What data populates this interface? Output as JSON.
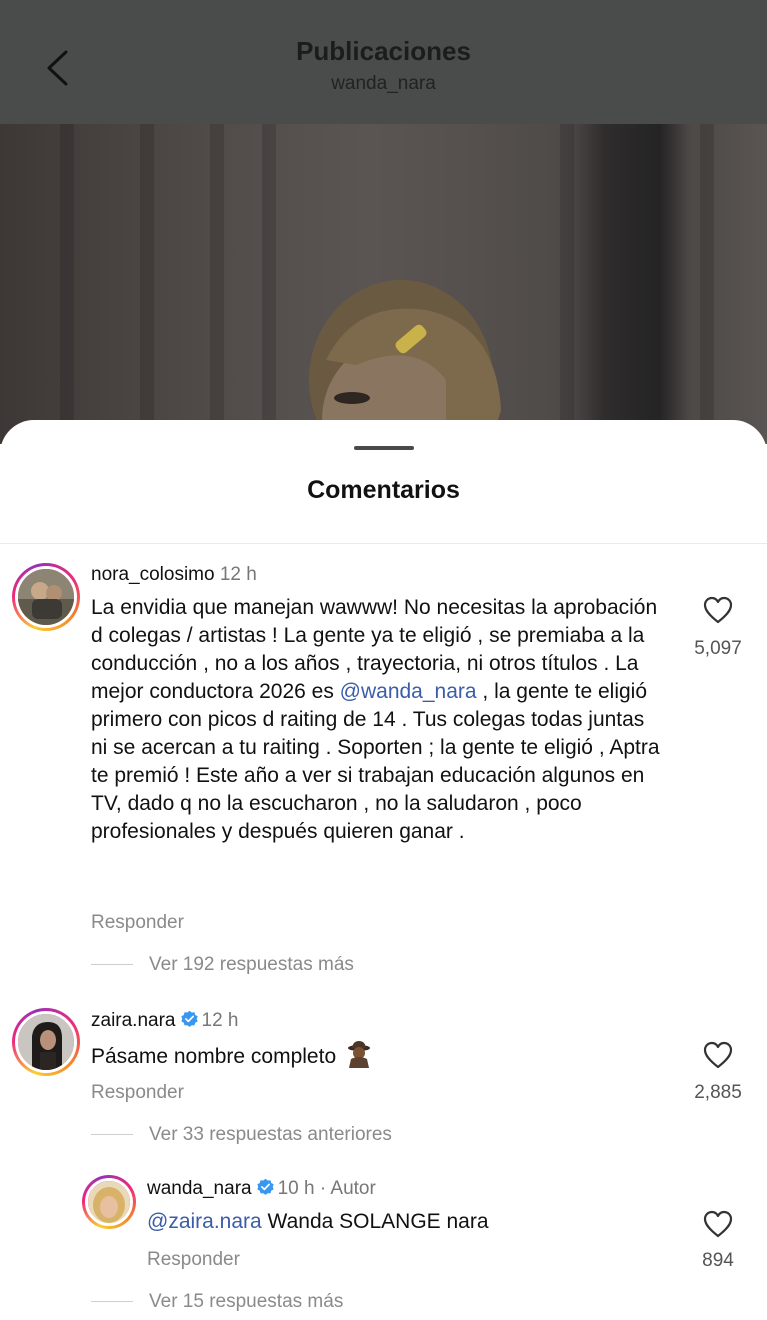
{
  "header": {
    "title": "Publicaciones",
    "username": "wanda_nara"
  },
  "sheet": {
    "title": "Comentarios"
  },
  "comments": [
    {
      "username": "nora_colosimo",
      "time": "12 h",
      "text_before": "La envidia que manejan  wawww! No necesitas la aprobación d colegas / artistas ! La gente ya te eligió , se premiaba a la conducción , no a los años , trayectoria, ni otros títulos . La mejor conductora 2026 es ",
      "mention": "@wanda_nara",
      "text_after": " , la gente te eligió primero con picos d raiting de 14 . Tus colegas todas juntas ni se acercan a tu raiting . Soporten ; la gente te eligió , Aptra te premió ! Este año a ver si trabajan educación algunos en TV, dado q no la escucharon , no la saludaron , poco profesionales y después quieren ganar .",
      "reply_label": "Responder",
      "likes": "5,097",
      "more_replies": "Ver 192 respuestas más"
    },
    {
      "username": "zaira.nara",
      "time": "12 h",
      "text": "Pásame nombre completo",
      "reply_label": "Responder",
      "likes": "2,885",
      "more_replies": "Ver 33 respuestas anteriores"
    }
  ],
  "reply": {
    "username": "wanda_nara",
    "meta": "10 h · Autor",
    "mention": "@zaira.nara",
    "text": " Wanda SOLANGE nara",
    "reply_label": "Responder",
    "likes": "894",
    "more_replies": "Ver 15 respuestas más"
  },
  "icons": {
    "back": "chevron-left-icon",
    "like": "heart-outline-icon",
    "verified": "verified-badge-icon",
    "emoji": "detective-emoji"
  },
  "colors": {
    "header_bg": "#4a4b4b",
    "mention": "#3b5da8",
    "verified": "#3897f0",
    "meta_text": "#8a8a8a"
  }
}
